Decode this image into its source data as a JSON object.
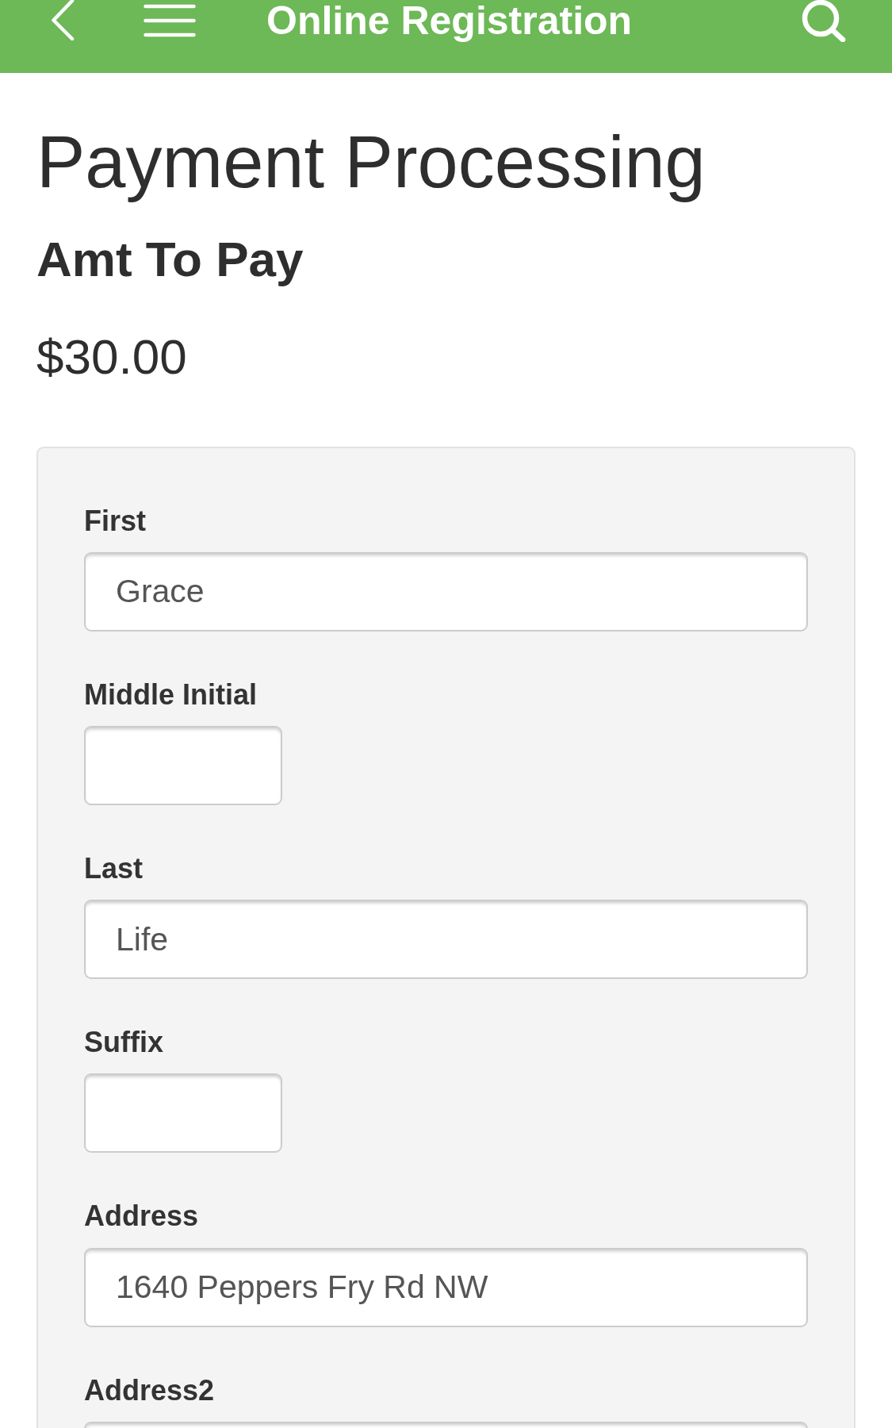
{
  "header": {
    "title": "Online Registration"
  },
  "page": {
    "title": "Payment Processing",
    "amount_label": "Amt To Pay",
    "amount": "$30.00"
  },
  "form": {
    "fields": [
      {
        "label": "First",
        "value": "Grace",
        "kind": "wide"
      },
      {
        "label": "Middle Initial",
        "kind": "short"
      },
      {
        "label": "Last",
        "value": "Life",
        "kind": "wide"
      },
      {
        "label": "Suffix",
        "kind": "short"
      },
      {
        "label": "Address",
        "value": "1640 Peppers Fry Rd NW",
        "kind": "wide"
      },
      {
        "label": "Address2",
        "kind": "wide"
      }
    ]
  }
}
